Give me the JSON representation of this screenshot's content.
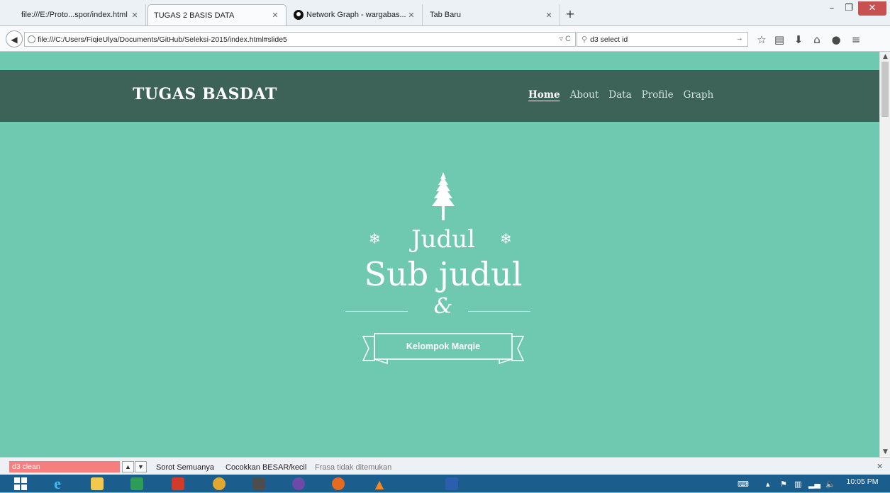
{
  "browser": {
    "tabs": [
      {
        "title": "file:///E:/Proto...spor/index.html",
        "active": false
      },
      {
        "title": "TUGAS 2 BASIS DATA",
        "active": true
      },
      {
        "title": "Network Graph - wargabas...",
        "active": false,
        "icon": "github-icon"
      },
      {
        "title": "Tab Baru",
        "active": false
      }
    ],
    "new_tab_label": "+",
    "url": "file:///C:/Users/FiqieUlya/Documents/GitHub/Seleksi-2015/index.html#slide5",
    "search_value": "d3 select id"
  },
  "site": {
    "brand": "TUGAS BASDAT",
    "menu": [
      {
        "label": "Home",
        "current": true
      },
      {
        "label": "About",
        "current": false
      },
      {
        "label": "Data",
        "current": false
      },
      {
        "label": "Profile",
        "current": false
      },
      {
        "label": "Graph",
        "current": false
      }
    ],
    "hero": {
      "title": "Judul",
      "subtitle": "Sub judul",
      "ampersand": "&",
      "ribbon": "Kelompok Marqie"
    },
    "colors": {
      "background": "#6ec9b0",
      "header": "#3d6358",
      "text": "#ffffff"
    }
  },
  "findbar": {
    "query": "d3 clean",
    "highlight_all": "Sorot Semuanya",
    "match_case": "Cocokkan BESAR/kecil",
    "status": "Frasa tidak ditemukan"
  },
  "taskbar": {
    "clock": "10:05 PM"
  }
}
